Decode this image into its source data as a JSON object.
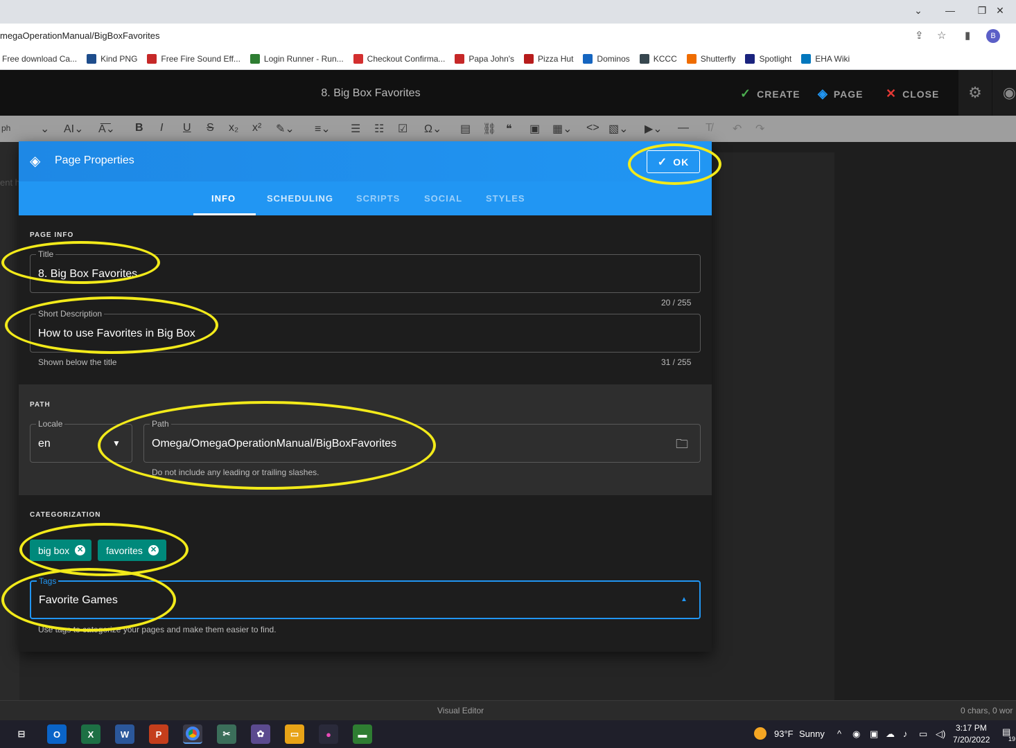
{
  "browser": {
    "url": "megaOperationManual/BigBoxFavorites",
    "profile_initial": "B",
    "bookmarks": [
      {
        "label": "Free download Ca...",
        "color": "#4caf50"
      },
      {
        "label": "Kind PNG",
        "color": "#1e4d8c"
      },
      {
        "label": "Free Fire Sound Eff...",
        "color": "#c62828"
      },
      {
        "label": "Login Runner - Run...",
        "color": "#2e7d32"
      },
      {
        "label": "Checkout Confirma...",
        "color": "#d32f2f"
      },
      {
        "label": "Papa John's",
        "color": "#c62828"
      },
      {
        "label": "Pizza Hut",
        "color": "#b71c1c"
      },
      {
        "label": "Dominos",
        "color": "#1565c0"
      },
      {
        "label": "KCCC",
        "color": "#37474f"
      },
      {
        "label": "Shutterfly",
        "color": "#ef6c00"
      },
      {
        "label": "Spotlight",
        "color": "#1a237e"
      },
      {
        "label": "EHA Wiki",
        "color": "#0277bd"
      }
    ]
  },
  "app": {
    "title": "8. Big Box Favorites",
    "create_label": "CREATE",
    "page_label": "PAGE",
    "close_label": "CLOSE"
  },
  "toolbar": {
    "paragraph_label": "ph"
  },
  "editor": {
    "placeholder_fragment": "ent h"
  },
  "dialog": {
    "title": "Page Properties",
    "ok_label": "OK",
    "tabs": [
      "INFO",
      "SCHEDULING",
      "SCRIPTS",
      "SOCIAL",
      "STYLES"
    ],
    "active_tab": "INFO",
    "page_info": {
      "section_label": "PAGE INFO",
      "title_label": "Title",
      "title_value": "8. Big Box Favorites",
      "title_counter": "20 / 255",
      "desc_label": "Short Description",
      "desc_value": "How to use Favorites in Big Box",
      "desc_hint": "Shown below the title",
      "desc_counter": "31 / 255"
    },
    "path": {
      "section_label": "PATH",
      "locale_label": "Locale",
      "locale_value": "en",
      "path_label": "Path",
      "path_value": "Omega/OmegaOperationManual/BigBoxFavorites",
      "path_hint": "Do not include any leading or trailing slashes."
    },
    "categorization": {
      "section_label": "CATEGORIZATION",
      "chips": [
        "big box",
        "favorites"
      ],
      "tags_label": "Tags",
      "tags_value": "Favorite Games",
      "tags_hint": "Use tags to categorize your pages and make them easier to find."
    }
  },
  "statusbar": {
    "mode": "Visual Editor",
    "counts": "0 chars, 0 wor"
  },
  "taskbar": {
    "weather_temp": "93°F",
    "weather_desc": "Sunny",
    "time": "3:17 PM",
    "date": "7/20/2022",
    "notif_count": "19"
  },
  "colors": {
    "accent_blue": "#2196f3",
    "chip_teal": "#00897b",
    "annotation_yellow": "#f2ea1a"
  }
}
